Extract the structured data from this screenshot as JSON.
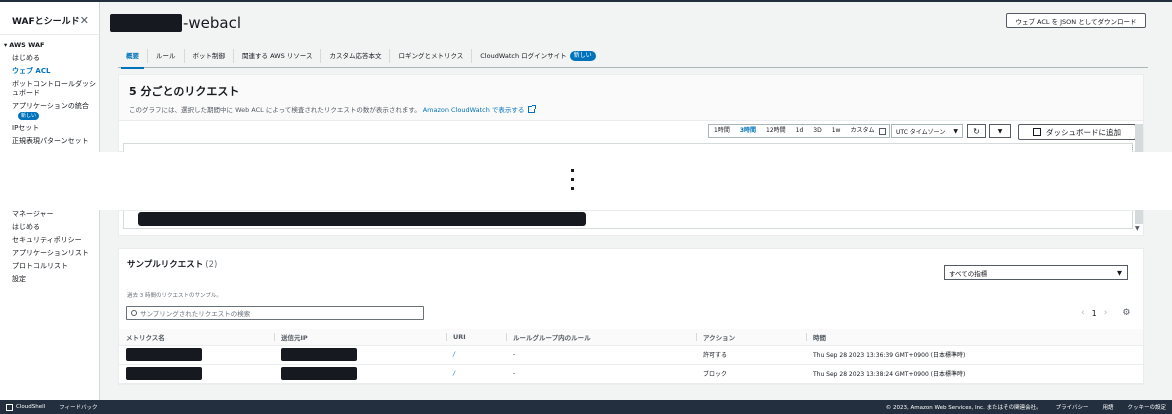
{
  "sidebar": {
    "title": "WAFとシールド",
    "section_waf": "AWS WAF",
    "items": [
      {
        "label": "はじめる",
        "active": false
      },
      {
        "label": "ウェブ ACL",
        "active": true
      },
      {
        "label": "ボットコントロールダッシュボード",
        "active": false
      },
      {
        "label": "アプリケーションの統合",
        "active": false,
        "badge": "新しい"
      },
      {
        "label": "IPセット",
        "active": false
      },
      {
        "label": "正規表現パターンセット",
        "active": false
      }
    ],
    "section_manager": "マネージャー",
    "manager_items": [
      {
        "label": "はじめる"
      },
      {
        "label": "セキュリティポリシー"
      },
      {
        "label": "アプリケーションリスト"
      },
      {
        "label": "プロトコルリスト"
      },
      {
        "label": "設定"
      }
    ]
  },
  "header": {
    "title_suffix": "-webacl",
    "download_button": "ウェブ ACL を JSON としてダウンロード"
  },
  "tabs": [
    {
      "label": "概要",
      "active": true
    },
    {
      "label": "ルール"
    },
    {
      "label": "ボット制御"
    },
    {
      "label": "関連する AWS リソース"
    },
    {
      "label": "カスタム応答本文"
    },
    {
      "label": "ロギングとメトリクス"
    },
    {
      "label": "CloudWatch ログインサイト",
      "badge": "新しい"
    }
  ],
  "requests_panel": {
    "title": "5 分ごとのリクエスト",
    "description": "このグラフには、選択した期間中に Web ACL によって検査されたリクエストの数が表示されます。",
    "cloudwatch_link": "Amazon CloudWatch で表示する",
    "time_ranges": [
      "1時間",
      "3時間",
      "12時間",
      "1d",
      "3D",
      "1w",
      "カスタム"
    ],
    "selected_range": "3時間",
    "timezone": "UTC タイムゾーン",
    "dashboard_button": "ダッシュボードに追加"
  },
  "samples_panel": {
    "title": "サンプルリクエスト",
    "count": "(2)",
    "metric_select": "すべての指標",
    "description": "過去 3 時間のリクエストのサンプル。",
    "search_placeholder": "サンプリングされたリクエストの検索",
    "page": "1",
    "columns": [
      "メトリクス名",
      "送信元IP",
      "URI",
      "ルールグループ内のルール",
      "アクション",
      "時間"
    ],
    "rows": [
      {
        "uri": "/",
        "rule": "-",
        "action": "許可する",
        "time": "Thu Sep 28 2023 13:36:39 GMT+0900 (日本標準時)"
      },
      {
        "uri": "/",
        "rule": "-",
        "action": "ブロック",
        "time": "Thu Sep 28 2023 13:38:24 GMT+0900 (日本標準時)"
      }
    ]
  },
  "footer": {
    "cloudshell": "CloudShell",
    "feedback": "フィードバック",
    "copyright": "© 2023, Amazon Web Services, Inc. またはその関連会社。",
    "privacy": "プライバシー",
    "terms": "用語",
    "cookie": "クッキーの設定"
  },
  "colors": {
    "accent": "#0073bb",
    "nav_dark": "#232f3e",
    "redaction": "#16191f"
  }
}
